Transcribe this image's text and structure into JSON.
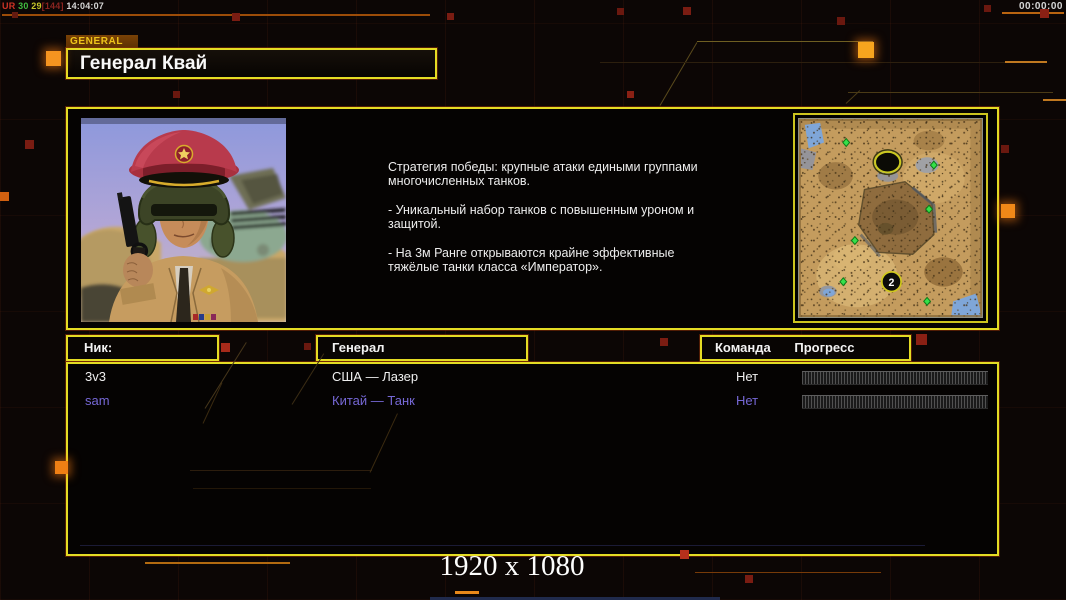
{
  "hud": {
    "debug": {
      "net": "UR",
      "fps": "30",
      "ping": "29",
      "bracket": "[144]",
      "time": "14:04:07"
    },
    "timer": "00:00:00"
  },
  "tab": {
    "label": "GENERAL"
  },
  "header": {
    "title": "Генерал Квай"
  },
  "info": {
    "p1": "Стратегия победы: крупные атаки едиными группами многочисленных танков.",
    "p2": "- Уникальный набор танков с повышенным уроном и защитой.",
    "p3": "- На 3м Ранге открываются крайне эффективные тяжёлые танки класса «Император»."
  },
  "minimap": {
    "marker_start_label": "2"
  },
  "table": {
    "headers": {
      "nick": "Ник:",
      "general": "Генерал",
      "team": "Команда",
      "progress": "Прогресс"
    },
    "rows": [
      {
        "nick": "3v3",
        "general": "США — Лазер",
        "team": "Нет"
      },
      {
        "nick": "sam",
        "general": "Китай — Танк",
        "team": "Нет"
      }
    ]
  },
  "watermark": "1920 x 1080",
  "colors": {
    "accent_yellow": "#e4dc24",
    "tab_text": "#eec41a",
    "tab_background": "#6b3803",
    "remote_player": "#7668d6",
    "circuit_orange": "#b05a0a",
    "progress_track": "#515151"
  }
}
